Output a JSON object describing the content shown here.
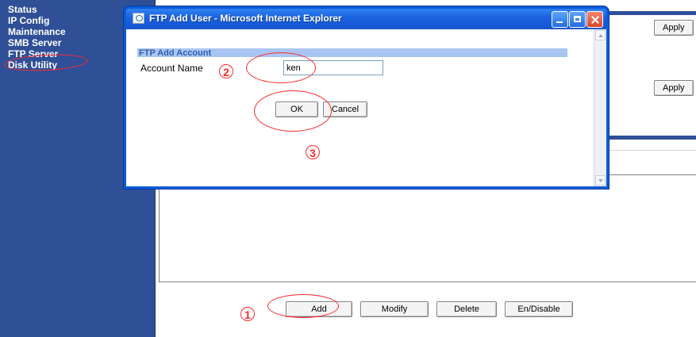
{
  "nav": {
    "items": [
      {
        "label": "Status"
      },
      {
        "label": "IP Config"
      },
      {
        "label": "Maintenance"
      },
      {
        "label": "SMB Server"
      },
      {
        "label": "FTP Server"
      },
      {
        "label": "Disk Utility"
      }
    ]
  },
  "main": {
    "apply_label_top": "Apply",
    "apply_label_mid": "Apply",
    "actions": {
      "add": "Add",
      "modify": "Modify",
      "delete": "Delete",
      "en_disable": "En/Disable"
    }
  },
  "popup": {
    "title": "FTP Add User - Microsoft Internet Explorer",
    "section_header": "FTP Add Account",
    "account_label": "Account Name",
    "account_value": "ken",
    "ok_label": "OK",
    "cancel_label": "Cancel"
  },
  "annotations": {
    "steps": [
      "1",
      "2",
      "3"
    ]
  },
  "colors": {
    "nav_blue": "#2f4f97",
    "window_blue": "#0b5bd6",
    "section_blue": "#a9c5f3",
    "annotation_red": "#ff2a2a"
  },
  "icons": {
    "app": "ie-icon",
    "minimize": "minimize-icon",
    "maximize": "maximize-icon",
    "close": "close-icon"
  }
}
